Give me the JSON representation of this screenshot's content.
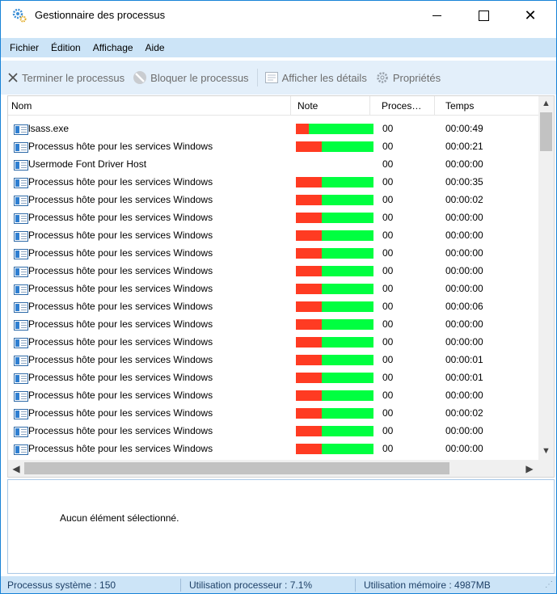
{
  "window": {
    "title": "Gestionnaire des processus",
    "controls": {
      "minimize": "",
      "maximize": "",
      "close": "✕"
    }
  },
  "menu": {
    "items": [
      "Fichier",
      "Édition",
      "Affichage",
      "Aide"
    ]
  },
  "toolbar": {
    "end_process": "Terminer le processus",
    "block_process": "Bloquer le processus",
    "show_details": "Afficher les détails",
    "properties": "Propriétés"
  },
  "list": {
    "columns": [
      "Nom",
      "Note",
      "Proces…",
      "Temps"
    ],
    "rows": [
      {
        "name": "lsass.exe",
        "note_red_fraction": 0.17,
        "proc": "00",
        "time": "00:00:49"
      },
      {
        "name": "Processus hôte pour les services Windows",
        "note_red_fraction": 0.33,
        "proc": "00",
        "time": "00:00:21"
      },
      {
        "name": "Usermode Font Driver Host",
        "note_red_fraction": null,
        "proc": "00",
        "time": "00:00:00"
      },
      {
        "name": "Processus hôte pour les services Windows",
        "note_red_fraction": 0.33,
        "proc": "00",
        "time": "00:00:35"
      },
      {
        "name": "Processus hôte pour les services Windows",
        "note_red_fraction": 0.33,
        "proc": "00",
        "time": "00:00:02"
      },
      {
        "name": "Processus hôte pour les services Windows",
        "note_red_fraction": 0.33,
        "proc": "00",
        "time": "00:00:00"
      },
      {
        "name": "Processus hôte pour les services Windows",
        "note_red_fraction": 0.33,
        "proc": "00",
        "time": "00:00:00"
      },
      {
        "name": "Processus hôte pour les services Windows",
        "note_red_fraction": 0.33,
        "proc": "00",
        "time": "00:00:00"
      },
      {
        "name": "Processus hôte pour les services Windows",
        "note_red_fraction": 0.33,
        "proc": "00",
        "time": "00:00:00"
      },
      {
        "name": "Processus hôte pour les services Windows",
        "note_red_fraction": 0.33,
        "proc": "00",
        "time": "00:00:00"
      },
      {
        "name": "Processus hôte pour les services Windows",
        "note_red_fraction": 0.33,
        "proc": "00",
        "time": "00:00:06"
      },
      {
        "name": "Processus hôte pour les services Windows",
        "note_red_fraction": 0.33,
        "proc": "00",
        "time": "00:00:00"
      },
      {
        "name": "Processus hôte pour les services Windows",
        "note_red_fraction": 0.33,
        "proc": "00",
        "time": "00:00:00"
      },
      {
        "name": "Processus hôte pour les services Windows",
        "note_red_fraction": 0.33,
        "proc": "00",
        "time": "00:00:01"
      },
      {
        "name": "Processus hôte pour les services Windows",
        "note_red_fraction": 0.33,
        "proc": "00",
        "time": "00:00:01"
      },
      {
        "name": "Processus hôte pour les services Windows",
        "note_red_fraction": 0.33,
        "proc": "00",
        "time": "00:00:00"
      },
      {
        "name": "Processus hôte pour les services Windows",
        "note_red_fraction": 0.33,
        "proc": "00",
        "time": "00:00:02"
      },
      {
        "name": "Processus hôte pour les services Windows",
        "note_red_fraction": 0.33,
        "proc": "00",
        "time": "00:00:00"
      },
      {
        "name": "Processus hôte pour les services Windows",
        "note_red_fraction": 0.33,
        "proc": "00",
        "time": "00:00:00"
      }
    ]
  },
  "details": {
    "text": "Aucun élément sélectionné."
  },
  "status": {
    "system_processes": "Processus système : 150",
    "cpu_usage": "Utilisation processeur : 7.1%",
    "memory_usage": "Utilisation mémoire : 4987MB"
  },
  "colors": {
    "accent": "#cce4f7",
    "toolbar_bg": "#e3effa",
    "note_good": "#00ff40",
    "note_bad": "#ff3b22",
    "window_border": "#1883d7"
  },
  "icons": {
    "app": "gear-cluster-icon",
    "end_process": "x-icon",
    "block_process": "block-icon",
    "show_details": "details-icon",
    "properties": "gear-icon",
    "row": "window-app-icon"
  }
}
